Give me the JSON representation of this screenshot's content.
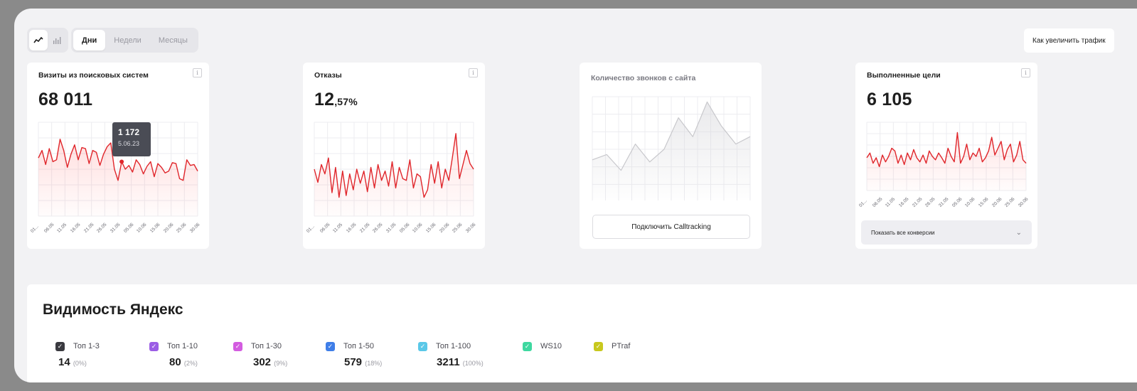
{
  "toolbar": {
    "chart_toggle": [
      "line-chart-icon",
      "bar-chart-icon"
    ],
    "periods": [
      "Дни",
      "Недели",
      "Месяцы"
    ],
    "active_period": "Дни",
    "help_label": "Как увеличить трафик"
  },
  "cards": {
    "visits": {
      "title": "Визиты из поисковых систем",
      "value": "68 011",
      "tooltip_value": "1 172",
      "tooltip_date": "5.06.23",
      "ticks": [
        "01...",
        "06.05",
        "11.05",
        "16.05",
        "21.05",
        "26.05",
        "31.05",
        "05.06",
        "10.06",
        "15.06",
        "20.06",
        "25.06",
        "30.06"
      ]
    },
    "bounces": {
      "title": "Отказы",
      "value_main": "12",
      "value_frac": ",57%",
      "ticks": [
        "01...",
        "06.05",
        "11.05",
        "16.05",
        "21.05",
        "26.05",
        "31.05",
        "05.06",
        "10.06",
        "15.06",
        "20.06",
        "25.06",
        "30.06"
      ]
    },
    "calls": {
      "title": "Количество звонков с сайта",
      "button_label": "Подключить Calltracking"
    },
    "goals": {
      "title": "Выполненные цели",
      "value": "6 105",
      "select_label": "Показать все конверсии",
      "ticks": [
        "01...",
        "06.05",
        "11.05",
        "16.05",
        "21.05",
        "26.05",
        "31.05",
        "05.06",
        "10.06",
        "15.06",
        "20.06",
        "25.06",
        "30.06"
      ]
    }
  },
  "visibility": {
    "title": "Видимость Яндекс",
    "items": [
      {
        "label": "Топ 1-3",
        "value": "14",
        "pct": "(0%)",
        "color": "#3a3a40"
      },
      {
        "label": "Топ 1-10",
        "value": "80",
        "pct": "(2%)",
        "color": "#9b5de5"
      },
      {
        "label": "Топ 1-30",
        "value": "302",
        "pct": "(9%)",
        "color": "#d35ce0"
      },
      {
        "label": "Топ 1-50",
        "value": "579",
        "pct": "(18%)",
        "color": "#3f7ee8"
      },
      {
        "label": "Топ 1-100",
        "value": "3211",
        "pct": "(100%)",
        "color": "#5ac8e8"
      },
      {
        "label": "WS10",
        "value": "",
        "pct": "",
        "color": "#3ed8a0"
      },
      {
        "label": "PTraf",
        "value": "",
        "pct": "",
        "color": "#c8c81e"
      }
    ]
  },
  "series": {
    "visits": [
      0.62,
      0.7,
      0.55,
      0.72,
      0.58,
      0.6,
      0.82,
      0.7,
      0.52,
      0.66,
      0.76,
      0.6,
      0.73,
      0.72,
      0.56,
      0.7,
      0.68,
      0.54,
      0.66,
      0.74,
      0.78,
      0.5,
      0.38,
      0.58,
      0.5,
      0.54,
      0.47,
      0.6,
      0.55,
      0.45,
      0.53,
      0.58,
      0.42,
      0.56,
      0.52,
      0.46,
      0.48,
      0.57,
      0.56,
      0.4,
      0.38,
      0.6,
      0.54,
      0.55,
      0.48
    ],
    "bounces": [
      0.5,
      0.36,
      0.55,
      0.45,
      0.62,
      0.25,
      0.52,
      0.2,
      0.48,
      0.22,
      0.45,
      0.28,
      0.5,
      0.35,
      0.48,
      0.26,
      0.52,
      0.3,
      0.55,
      0.38,
      0.48,
      0.32,
      0.58,
      0.3,
      0.52,
      0.4,
      0.38,
      0.6,
      0.3,
      0.45,
      0.42,
      0.2,
      0.28,
      0.55,
      0.35,
      0.58,
      0.3,
      0.5,
      0.38,
      0.62,
      0.88,
      0.4,
      0.55,
      0.7,
      0.56,
      0.5
    ],
    "calls": [
      0.4,
      0.45,
      0.3,
      0.55,
      0.38,
      0.5,
      0.8,
      0.62,
      0.95,
      0.72,
      0.55,
      0.62
    ],
    "goals": [
      0.48,
      0.55,
      0.4,
      0.48,
      0.35,
      0.52,
      0.42,
      0.5,
      0.62,
      0.58,
      0.4,
      0.52,
      0.38,
      0.55,
      0.45,
      0.6,
      0.48,
      0.42,
      0.52,
      0.4,
      0.58,
      0.5,
      0.45,
      0.55,
      0.48,
      0.4,
      0.62,
      0.5,
      0.42,
      0.85,
      0.4,
      0.5,
      0.68,
      0.45,
      0.55,
      0.5,
      0.62,
      0.42,
      0.48,
      0.58,
      0.78,
      0.52,
      0.62,
      0.72,
      0.45,
      0.6,
      0.68,
      0.42,
      0.52,
      0.72,
      0.45,
      0.4
    ],
    "tooltip_index": 23
  }
}
